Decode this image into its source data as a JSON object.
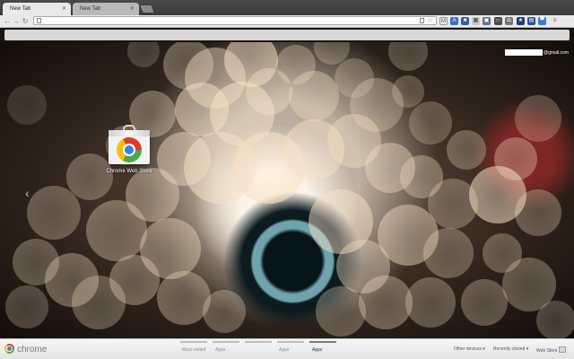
{
  "tabs": [
    {
      "title": "New Tab",
      "active": true
    },
    {
      "title": "New Tab",
      "active": false
    }
  ],
  "account": {
    "email_suffix": "@gmail.com"
  },
  "apps": [
    {
      "label": "Chrome Web Store",
      "icon": "chrome-web-store-icon"
    }
  ],
  "footer": {
    "brand": "chrome",
    "pages": [
      {
        "label": "Most visited",
        "selected": false
      },
      {
        "label": "Apps",
        "selected": false
      },
      {
        "label": "Apps",
        "selected": false
      },
      {
        "label": "Apps",
        "selected": true
      }
    ],
    "other_devices": "Other devices",
    "recently_closed": "Recently closed",
    "web_store": "Web Store"
  },
  "colors": {
    "accent": "#3a7fd8",
    "footer_bg": "#eeeeee",
    "tabstrip": "#3f3f3f"
  }
}
